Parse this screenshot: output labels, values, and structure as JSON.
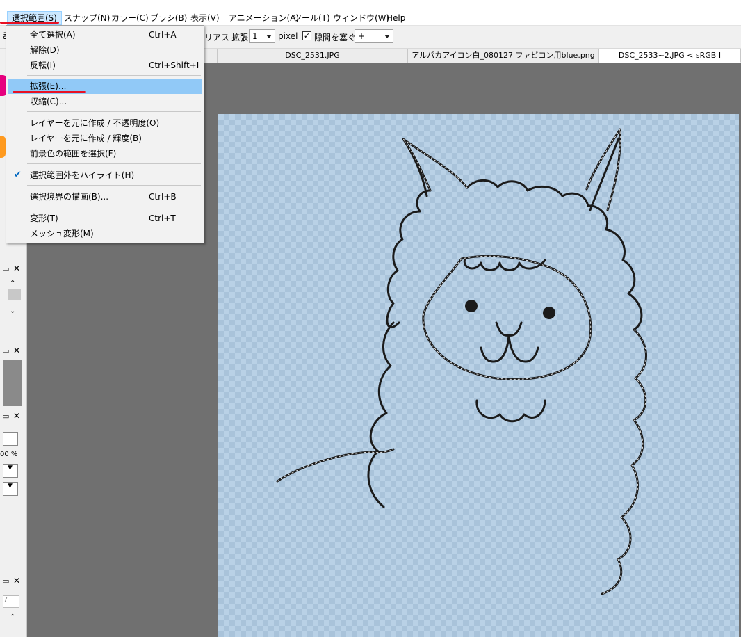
{
  "menubar": {
    "items": [
      "選択範囲(S)",
      "スナップ(N)",
      "カラー(C)",
      "ブラシ(B)",
      "表示(V)",
      "アニメーション(A)",
      "ツール(T)",
      "ウィンドウ(W)",
      "Help"
    ]
  },
  "toolbar": {
    "partial_label": "リアス",
    "expand_label": "拡張",
    "expand_value": "1",
    "unit": "pixel",
    "gap_checked": true,
    "gap_label": "隙間を塞ぐ",
    "gap_value": "+"
  },
  "tabs": [
    "DSC_2531.JPG",
    "アルパカアイコン白_080127 ファビコン用blue.png",
    "DSC_2533~2.JPG < sRGB I"
  ],
  "dropdown": {
    "items": [
      {
        "label": "全て選択(A)",
        "shortcut": "Ctrl+A"
      },
      {
        "label": "解除(D)",
        "shortcut": ""
      },
      {
        "label": "反転(I)",
        "shortcut": "Ctrl+Shift+I"
      },
      {
        "label": "拡張(E)...",
        "shortcut": "",
        "highlighted": true
      },
      {
        "label": "収縮(C)...",
        "shortcut": ""
      },
      {
        "label": "レイヤーを元に作成 / 不透明度(O)",
        "shortcut": ""
      },
      {
        "label": "レイヤーを元に作成 / 輝度(B)",
        "shortcut": ""
      },
      {
        "label": "前景色の範囲を選択(F)",
        "shortcut": ""
      },
      {
        "label": "選択範囲外をハイライト(H)",
        "shortcut": "",
        "checked": true
      },
      {
        "label": "選択境界の描画(B)...",
        "shortcut": "Ctrl+B"
      },
      {
        "label": "変形(T)",
        "shortcut": "Ctrl+T"
      },
      {
        "label": "メッシュ変形(M)",
        "shortcut": ""
      }
    ]
  },
  "left_panel": {
    "opacity_text": "00 %",
    "partial_number": "7"
  },
  "colors": {
    "highlight": "#91c9f7",
    "annotation_red": "#e81123",
    "workspace": "#707070",
    "canvas": "#b9d1e6"
  }
}
